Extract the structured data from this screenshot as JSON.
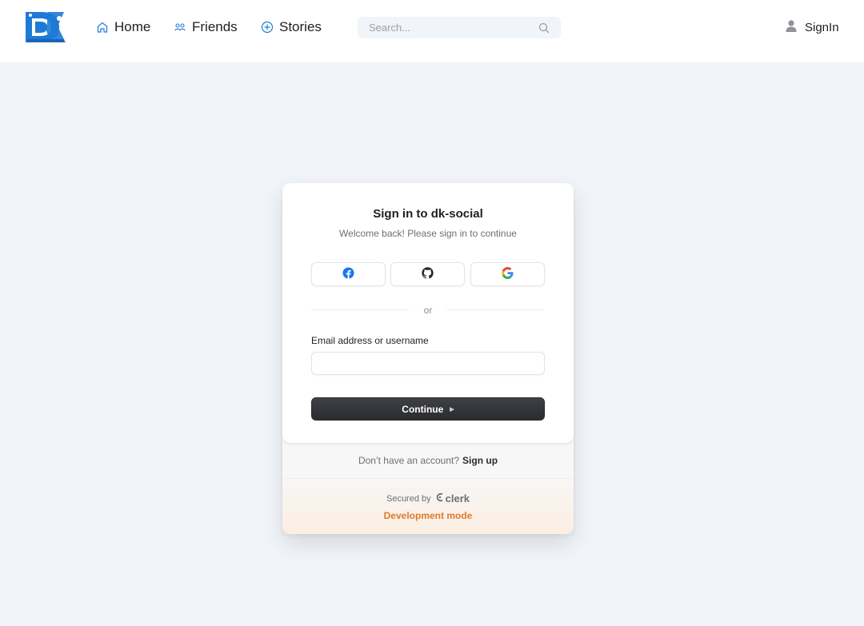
{
  "navbar": {
    "logo_text": "DK",
    "links": [
      {
        "label": "Home",
        "icon": "home-icon"
      },
      {
        "label": "Friends",
        "icon": "friends-icon"
      },
      {
        "label": "Stories",
        "icon": "add-circle-icon"
      }
    ],
    "search": {
      "placeholder": "Search...",
      "value": ""
    },
    "signin_label": "SignIn"
  },
  "signin": {
    "title": "Sign in to dk-social",
    "subtitle": "Welcome back! Please sign in to continue",
    "social_providers": [
      {
        "name": "Facebook",
        "icon": "facebook-icon",
        "color": "#1877f2"
      },
      {
        "name": "GitHub",
        "icon": "github-icon",
        "color": "#24292f"
      },
      {
        "name": "Google",
        "icon": "google-icon",
        "color": "#4285f4"
      }
    ],
    "divider_text": "or",
    "email_label": "Email address or username",
    "email_value": "",
    "continue_label": "Continue",
    "footer_prompt": "Don’t have an account?",
    "footer_link": "Sign up",
    "secured_by": "Secured by",
    "clerk_label": "clerk",
    "dev_mode_label": "Development mode"
  },
  "colors": {
    "page_background": "#f1f4f8",
    "brand_blue": "#1f7ad6",
    "continue_button": "#2f3034",
    "dev_mode": "#e07a2c"
  }
}
